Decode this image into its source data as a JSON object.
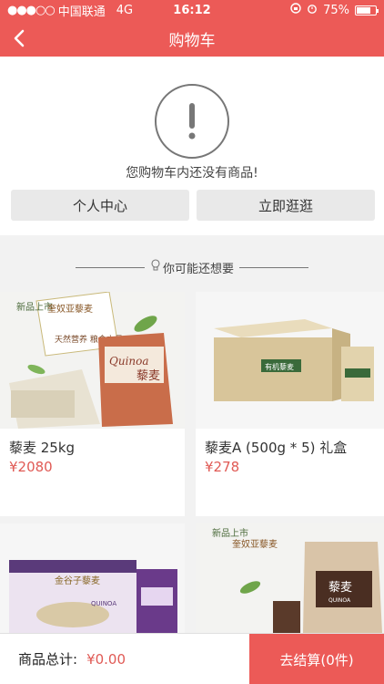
{
  "status_bar": {
    "carrier": "中国联通",
    "network": "4G",
    "time": "16:12",
    "battery": "75%",
    "battery_level": 0.75
  },
  "nav": {
    "title": "购物车",
    "back_icon": "chevron-left-icon"
  },
  "empty_cart": {
    "message": "您购物车内还没有商品!",
    "personal_center_label": "个人中心",
    "shop_now_label": "立即逛逛"
  },
  "recommend": {
    "header": "你可能还想要",
    "items": [
      {
        "name": "藜麦 25kg",
        "price": "¥2080"
      },
      {
        "name": "藜麦A (500g * 5) 礼盒",
        "price": "¥278"
      },
      {
        "name": "",
        "price": ""
      },
      {
        "name": "",
        "price": ""
      }
    ],
    "image_text": {
      "p1_badge": "新品上市",
      "p1_brand": "奎奴亚藜麦",
      "p1_slogan": "天然营养 粮食之母",
      "p1_bag_en": "Quinoa",
      "p1_bag_cn": "藜麦",
      "p2_box_label": "有机藜麦",
      "p3_brand": "金谷子藜麦",
      "p3_en": "QUINOA",
      "p4_badge": "新品上市",
      "p4_brand": "奎奴亚藜麦",
      "p4_box_cn": "藜麦",
      "p4_box_en": "QUINOA"
    }
  },
  "bottom_bar": {
    "total_label": "商品总计:",
    "total_value": "¥0.00",
    "checkout_label": "去结算(0件)"
  },
  "colors": {
    "accent": "#ec5a57",
    "price": "#e05a55"
  }
}
